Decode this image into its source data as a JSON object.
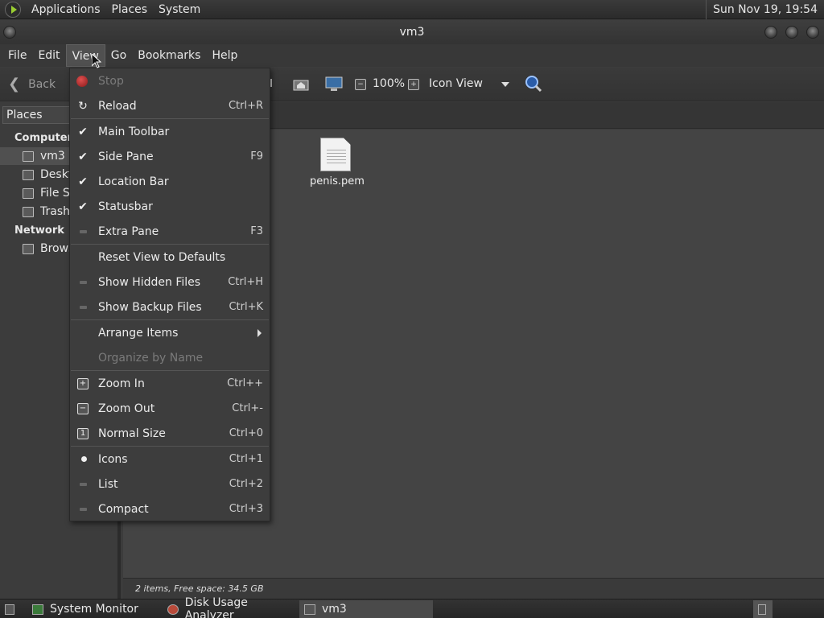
{
  "top_panel": {
    "menus": [
      "Applications",
      "Places",
      "System"
    ],
    "clock": "Sun Nov 19, 19:54"
  },
  "window": {
    "title": "vm3"
  },
  "menubar": [
    "File",
    "Edit",
    "View",
    "Go",
    "Bookmarks",
    "Help"
  ],
  "toolbar": {
    "back_label": "Back",
    "zoom": "100%",
    "view_mode": "Icon View"
  },
  "sidepane": {
    "header": "Places",
    "sections": {
      "computer": "Computer",
      "network": "Network"
    },
    "computer_items": [
      "vm3",
      "Deskt",
      "File Sy",
      "Trash"
    ],
    "network_items": [
      "Brows"
    ]
  },
  "content": {
    "files": [
      {
        "name": "penis.pem"
      }
    ]
  },
  "statusbar": {
    "text": "2 items, Free space: 34.5 GB"
  },
  "taskbar": [
    "System Monitor",
    "Disk Usage Analyzer",
    "vm3"
  ],
  "view_menu": {
    "items": [
      {
        "label": "Stop",
        "accel": "",
        "disabled": true
      },
      {
        "label": "Reload",
        "accel": "Ctrl+R"
      },
      {
        "label": "Main Toolbar",
        "accel": "",
        "checked": true
      },
      {
        "label": "Side Pane",
        "accel": "F9",
        "checked": true
      },
      {
        "label": "Location Bar",
        "accel": "",
        "checked": true
      },
      {
        "label": "Statusbar",
        "accel": "",
        "checked": true
      },
      {
        "label": "Extra Pane",
        "accel": "F3",
        "checked": false
      },
      {
        "label": "Reset View to Defaults",
        "accel": ""
      },
      {
        "label": "Show Hidden Files",
        "accel": "Ctrl+H",
        "checked": false
      },
      {
        "label": "Show Backup Files",
        "accel": "Ctrl+K",
        "checked": false
      },
      {
        "label": "Arrange Items",
        "accel": ""
      },
      {
        "label": "Organize by Name",
        "accel": "",
        "disabled": true
      },
      {
        "label": "Zoom In",
        "accel": "Ctrl++"
      },
      {
        "label": "Zoom Out",
        "accel": "Ctrl+-"
      },
      {
        "label": "Normal Size",
        "accel": "Ctrl+0"
      },
      {
        "label": "Icons",
        "accel": "Ctrl+1",
        "selected": true
      },
      {
        "label": "List",
        "accel": "Ctrl+2",
        "selected": false
      },
      {
        "label": "Compact",
        "accel": "Ctrl+3",
        "selected": false
      }
    ]
  }
}
